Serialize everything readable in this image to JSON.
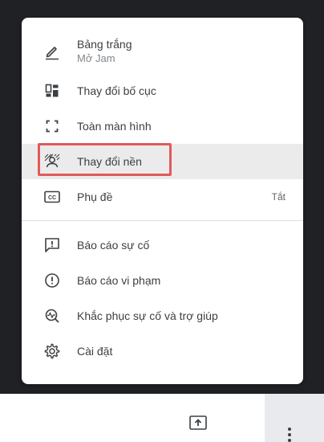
{
  "menu": {
    "items": [
      {
        "id": "whiteboard",
        "label": "Bảng trắng",
        "sublabel": "Mở Jam",
        "icon": "pencil-underline-icon"
      },
      {
        "id": "change-layout",
        "label": "Thay đổi bố cục",
        "icon": "layout-icon"
      },
      {
        "id": "fullscreen",
        "label": "Toàn màn hình",
        "icon": "fullscreen-icon"
      },
      {
        "id": "change-background",
        "label": "Thay đổi nền",
        "icon": "background-effect-icon"
      },
      {
        "id": "captions",
        "label": "Phụ đề",
        "trailing": "Tắt",
        "icon": "closed-caption-icon"
      },
      {
        "id": "report-problem",
        "label": "Báo cáo sự cố",
        "icon": "feedback-icon"
      },
      {
        "id": "report-abuse",
        "label": "Báo cáo vi phạm",
        "icon": "alert-circle-icon"
      },
      {
        "id": "troubleshoot",
        "label": "Khắc phục sự cố và trợ giúp",
        "icon": "troubleshoot-icon"
      },
      {
        "id": "settings",
        "label": "Cài đặt",
        "icon": "settings-gear-icon"
      }
    ]
  },
  "bottom_bar": {
    "present_icon": "present-screen-icon",
    "more_icon": "more-vertical-icon"
  },
  "colors": {
    "highlight": "#ebebeb",
    "annotation_box": "#e05a5a",
    "icon": "#3c4043"
  }
}
